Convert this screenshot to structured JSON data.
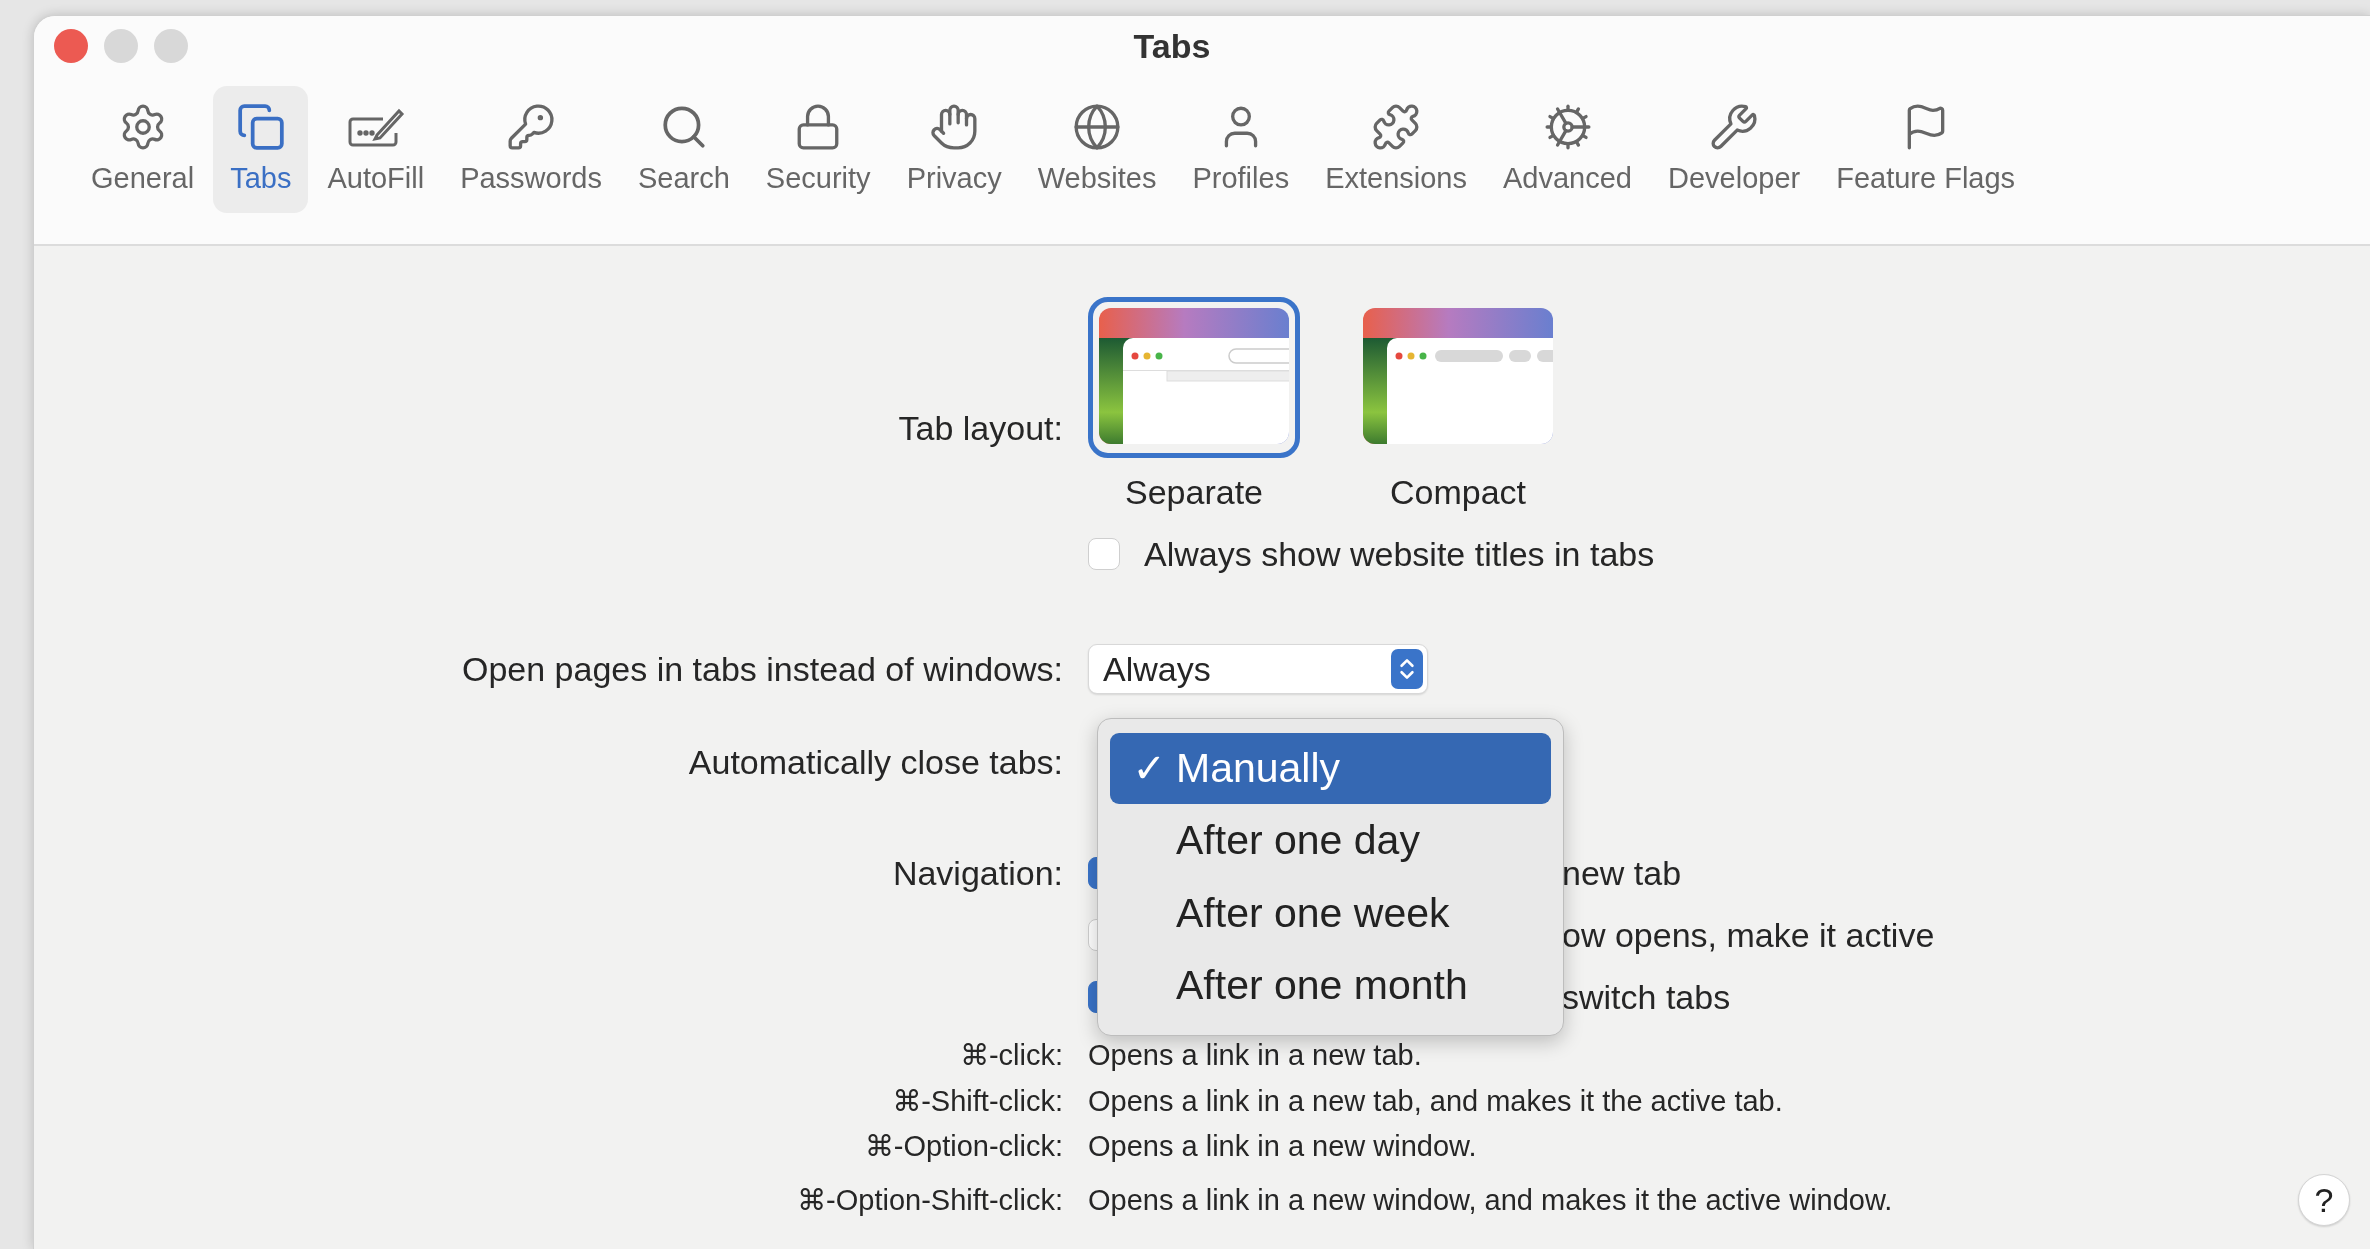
{
  "window": {
    "title": "Tabs"
  },
  "toolbar": [
    {
      "label": "General",
      "selected": false
    },
    {
      "label": "Tabs",
      "selected": true
    },
    {
      "label": "AutoFill",
      "selected": false
    },
    {
      "label": "Passwords",
      "selected": false
    },
    {
      "label": "Search",
      "selected": false
    },
    {
      "label": "Security",
      "selected": false
    },
    {
      "label": "Privacy",
      "selected": false
    },
    {
      "label": "Websites",
      "selected": false
    },
    {
      "label": "Profiles",
      "selected": false
    },
    {
      "label": "Extensions",
      "selected": false
    },
    {
      "label": "Advanced",
      "selected": false
    },
    {
      "label": "Developer",
      "selected": false
    },
    {
      "label": "Feature Flags",
      "selected": false
    }
  ],
  "tab_layout": {
    "label": "Tab layout:",
    "options": [
      {
        "label": "Separate",
        "selected": true
      },
      {
        "label": "Compact",
        "selected": false
      }
    ],
    "titles_checkbox": {
      "label": "Always show website titles in tabs",
      "checked": false
    }
  },
  "open_pages": {
    "label": "Open pages in tabs instead of windows:",
    "value": "Always"
  },
  "auto_close": {
    "label": "Automatically close tabs:"
  },
  "navigation": {
    "label": "Navigation:",
    "options": [
      {
        "label": "new tab",
        "checked": true
      },
      {
        "label": "ow opens, make it active",
        "checked": false
      },
      {
        "label": "switch tabs",
        "checked": true
      }
    ]
  },
  "shortcuts": [
    {
      "keys": "⌘-click:",
      "description": "Opens a link in a new tab."
    },
    {
      "keys": "⌘-Shift-click:",
      "description": "Opens a link in a new tab, and makes it the active tab."
    },
    {
      "keys": "⌘-Option-click:",
      "description": "Opens a link in a new window."
    },
    {
      "keys": "⌘-Option-Shift-click:",
      "description": "Opens a link in a new window, and makes it the active window."
    }
  ],
  "dropdown_menu": {
    "check_mark": "✓",
    "items": [
      {
        "label": "Manually",
        "selected": true
      },
      {
        "label": "After one day",
        "selected": false
      },
      {
        "label": "After one week",
        "selected": false
      },
      {
        "label": "After one month",
        "selected": false
      }
    ]
  },
  "help": {
    "label": "?"
  }
}
